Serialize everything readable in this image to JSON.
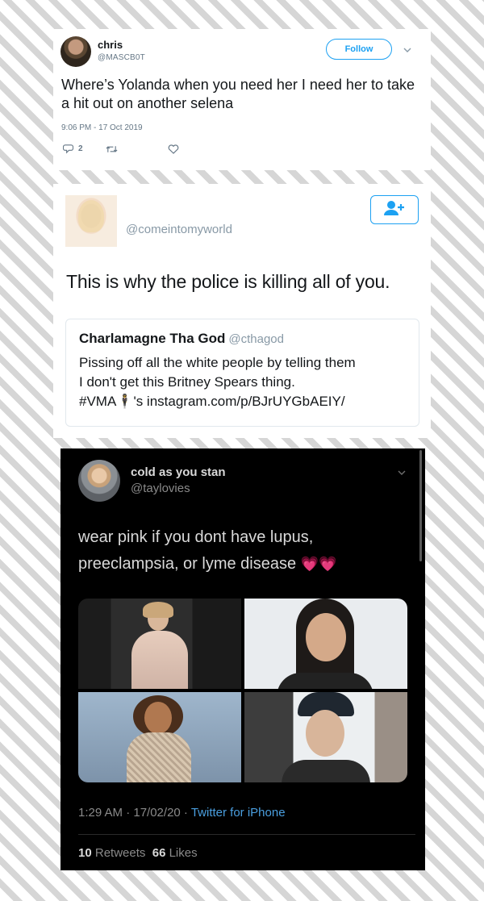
{
  "tweet1": {
    "display_name": "chris",
    "handle": "@MASCB0T",
    "follow_label": "Follow",
    "text": "Where’s Yolanda when you need her I need her to take a hit out on another selena",
    "timestamp": "9:06 PM - 17 Oct 2019",
    "reply_count": "2",
    "icons": [
      "reply-icon",
      "retweet-icon",
      "like-icon",
      "chevron-down-icon"
    ],
    "accent": "#1da1f2"
  },
  "tweet2": {
    "handle": "@comeintomyworld",
    "text": "This is why the police is killing all of you.",
    "quote": {
      "name": "Charlamagne Tha God",
      "handle": "@cthagod",
      "line1": "Pissing off all the white people by telling them",
      "line2": "I don't get this Britney Spears thing.",
      "line3": "#VMA🕴's instagram.com/p/BJrUYGbAEIY/"
    },
    "icons": [
      "follow-user-icon"
    ]
  },
  "tweet3": {
    "display_name": "cold as you stan",
    "handle": "@taylovies",
    "text": "wear pink if you dont have lupus, preeclampsia, or lyme disease",
    "emoji": "💗💗",
    "meta_time": "1:29 AM · 17/02/20 · ",
    "meta_source": "Twitter for iPhone",
    "retweet_count": "10",
    "retweet_label": "Retweets",
    "like_count": "66",
    "like_label": "Likes",
    "icons": [
      "chevron-down-icon"
    ]
  }
}
